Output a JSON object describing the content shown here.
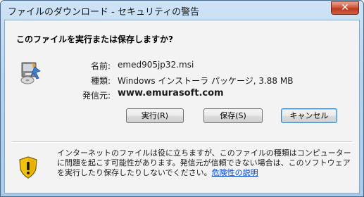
{
  "window": {
    "title": "ファイルのダウンロード - セキュリティの警告",
    "close_label": "✕"
  },
  "dialog": {
    "question": "このファイルを実行または保存しますか?",
    "file_icon": "installer-package-icon",
    "info": [
      {
        "label": "名前:",
        "value": "emed905jp32.msi"
      },
      {
        "label": "種類:",
        "value": "Windows インストーラ パッケージ, 3.88 MB"
      },
      {
        "label": "発信元:",
        "value": "www.emurasoft.com"
      }
    ],
    "buttons": {
      "run": "実行(R)",
      "save": "保存(S)",
      "cancel": "キャンセル"
    },
    "warning": {
      "icon": "security-shield-icon",
      "text": "インターネットのファイルは役に立ちますが、このファイルの種類はコンピューターに問題を起こす可能性があります。発信元が信頼できない場合は、このソフトウェアを実行したり保存したりしないでください。",
      "link": "危険性の説明"
    }
  },
  "colors": {
    "title_gradient_top": "#cfe3f6",
    "close_button": "#c8472c",
    "link": "#0044cc",
    "shield_yellow": "#f3c20c"
  }
}
